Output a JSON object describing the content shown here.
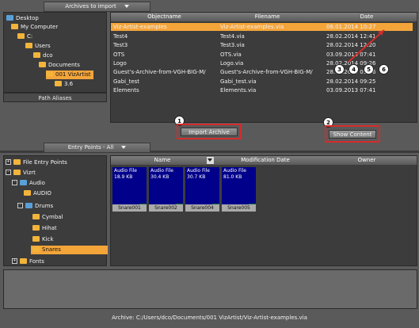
{
  "archives": {
    "title": "Archives to import",
    "tree": [
      {
        "label": "Desktop"
      },
      {
        "label": "My Computer"
      },
      {
        "label": "C:"
      },
      {
        "label": "Users"
      },
      {
        "label": "dco"
      },
      {
        "label": "Documents"
      },
      {
        "label": "001 VizArtist"
      },
      {
        "label": "3.6"
      }
    ],
    "path_aliases": "Path Aliases",
    "columns": [
      "Objectname",
      "Filename",
      "Date"
    ],
    "rows": [
      {
        "object": "Viz-Artist-examples",
        "file": "Viz-Artist-examples.via",
        "date": "08.01.2014 10:27"
      },
      {
        "object": "Test4",
        "file": "Test4.via",
        "date": "28.02.2014 12:41"
      },
      {
        "object": "Test3",
        "file": "Test3.via",
        "date": "28.02.2014 12:20"
      },
      {
        "object": "OTS",
        "file": "OTS.via",
        "date": "03.09.2013 07:41"
      },
      {
        "object": "Logo",
        "file": "Logo.via",
        "date": "28.02.2014 09:26"
      },
      {
        "object": "Guest's-Archive-from-VGH-BIG-M/",
        "file": "Guest's-Archive-from-VGH-BIG-M/",
        "date": "28.02.2014 09:26"
      },
      {
        "object": "Gabi_test",
        "file": "Gabi_test.via",
        "date": "28.02.2014 09:25"
      },
      {
        "object": "Elements",
        "file": "Elements.via",
        "date": "03.09.2013 07:41"
      }
    ],
    "import_button": "Import Archive",
    "show_content_button": "Show Content"
  },
  "callouts": [
    "1",
    "2",
    "3",
    "4",
    "5",
    "6"
  ],
  "entry": {
    "title": "Entry Points - All",
    "tree": [
      {
        "label": "File Entry Points"
      },
      {
        "label": "Vizrt"
      },
      {
        "label": "Audio"
      },
      {
        "label": "AUDIO"
      },
      {
        "label": "Drums"
      },
      {
        "label": "Cymbal"
      },
      {
        "label": "Hihat"
      },
      {
        "label": "Kick"
      },
      {
        "label": "Snares"
      },
      {
        "label": "Fonts"
      }
    ],
    "columns": [
      "Name",
      "Modification Date",
      "Owner"
    ],
    "items": [
      {
        "type": "Audio File",
        "size": "18.9 KB",
        "badge": "A",
        "name": "Snare001"
      },
      {
        "type": "Audio File",
        "size": "30.4 KB",
        "badge": "A",
        "name": "Snare002"
      },
      {
        "type": "Audio File",
        "size": "30.7 KB",
        "badge": "A",
        "name": "Snare004"
      },
      {
        "type": "Audio File",
        "size": "81.0 KB",
        "badge": "A",
        "name": "Snare005"
      }
    ]
  },
  "status": "Archive: C:/Users/dco/Documents/001 VizArtist/Viz-Artist-examples.via",
  "colors": {
    "selection": "#f4a53a",
    "highlight": "#d52b2b",
    "thumb": "#00008a"
  }
}
